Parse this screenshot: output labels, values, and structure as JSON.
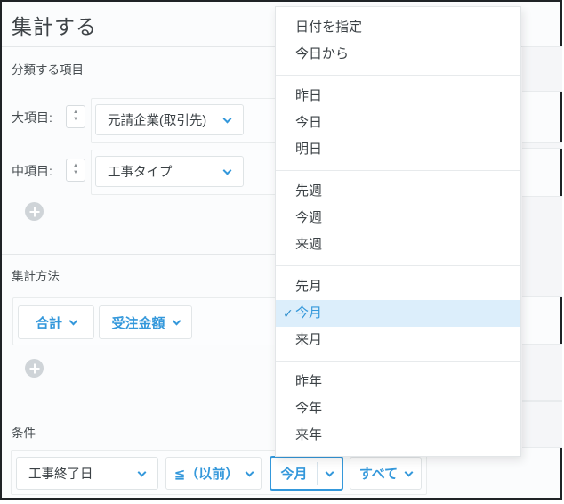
{
  "title": "集計する",
  "classify": {
    "label": "分類する項目",
    "rows": [
      {
        "label": "大項目:",
        "value": "元請企業(取引先)"
      },
      {
        "label": "中項目:",
        "value": "工事タイプ"
      }
    ]
  },
  "method": {
    "label": "集計方法",
    "buttons": [
      {
        "label": "合計"
      },
      {
        "label": "受注金額"
      }
    ]
  },
  "condition": {
    "label": "条件",
    "field": "工事終了日",
    "operator": "≦（以前）",
    "period": "今月",
    "scope": "すべて"
  },
  "menu": {
    "check": "✓",
    "groups": [
      {
        "items": [
          {
            "label": "日付を指定"
          },
          {
            "label": "今日から"
          }
        ]
      },
      {
        "items": [
          {
            "label": "昨日"
          },
          {
            "label": "今日"
          },
          {
            "label": "明日"
          }
        ]
      },
      {
        "items": [
          {
            "label": "先週"
          },
          {
            "label": "今週"
          },
          {
            "label": "来週"
          }
        ]
      },
      {
        "items": [
          {
            "label": "先月"
          },
          {
            "label": "今月",
            "selected": true
          },
          {
            "label": "来月"
          }
        ]
      },
      {
        "items": [
          {
            "label": "昨年"
          },
          {
            "label": "今年"
          },
          {
            "label": "来年"
          }
        ]
      }
    ]
  },
  "icons": {
    "chevron": "chevron-down",
    "plus": "plus",
    "check": "check",
    "spinner_up": "▲",
    "spinner_down": "▼"
  },
  "colors": {
    "accent": "#3498db",
    "selected_bg": "#dceefb",
    "box_border": "#e3e7e8",
    "frame_border": "#1f2326"
  }
}
